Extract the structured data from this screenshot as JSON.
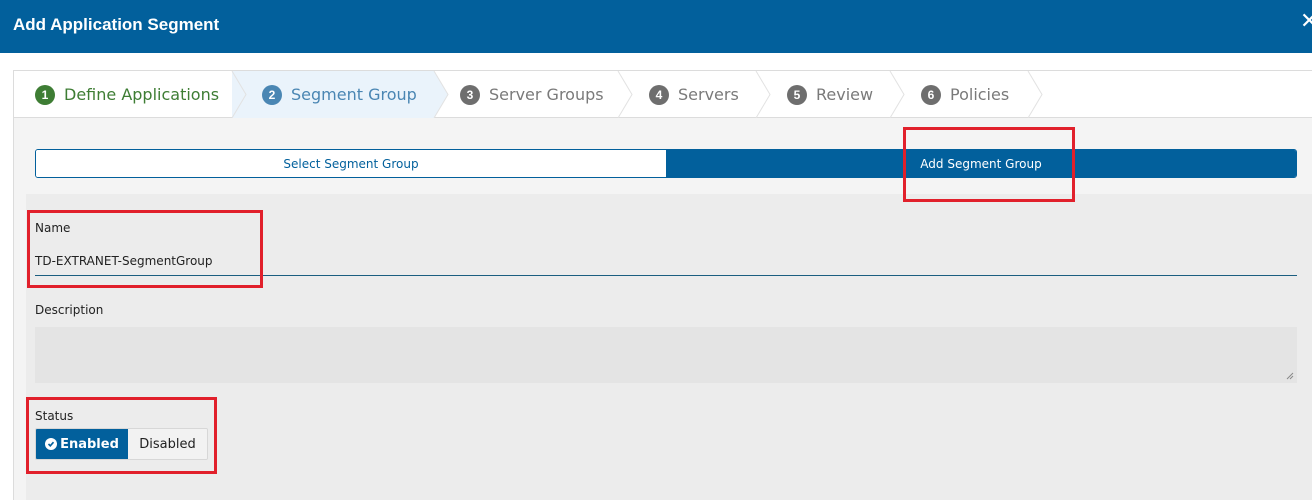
{
  "header": {
    "title": "Add Application Segment",
    "close_glyph": "✕"
  },
  "steps": [
    {
      "number": "1",
      "label": "Define Applications",
      "state": "done"
    },
    {
      "number": "2",
      "label": "Segment Group",
      "state": "active"
    },
    {
      "number": "3",
      "label": "Server Groups",
      "state": "pending"
    },
    {
      "number": "4",
      "label": "Servers",
      "state": "pending"
    },
    {
      "number": "5",
      "label": "Review",
      "state": "pending"
    },
    {
      "number": "6",
      "label": "Policies",
      "state": "pending"
    }
  ],
  "mode_toggle": {
    "select_label": "Select Segment Group",
    "add_label": "Add Segment Group",
    "selected": "Add Segment Group"
  },
  "form": {
    "name_label": "Name",
    "name_value": "TD-EXTRANET-SegmentGroup",
    "description_label": "Description",
    "description_value": "",
    "status_label": "Status",
    "status_enabled_label": "Enabled",
    "status_disabled_label": "Disabled",
    "status_selected": "Enabled"
  },
  "colors": {
    "brand_blue": "#02609c",
    "done_green": "#3e7d34",
    "active_blue": "#4a86b3",
    "highlight_red": "#e1202b"
  }
}
